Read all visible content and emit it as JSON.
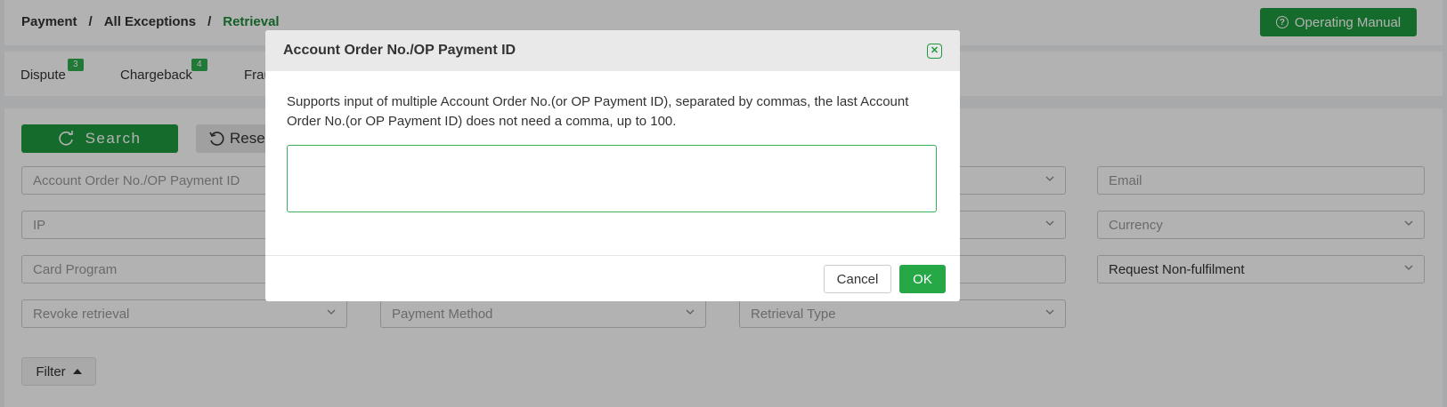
{
  "breadcrumb": {
    "items": [
      "Payment",
      "All Exceptions",
      "Retrieval"
    ],
    "separator": "/"
  },
  "header": {
    "manual_label": "Operating Manual",
    "manual_icon": "question-circle-icon"
  },
  "tabs": [
    {
      "label": "Dispute",
      "badge": "3"
    },
    {
      "label": "Chargeback",
      "badge": "4"
    },
    {
      "label": "Frau"
    }
  ],
  "actions": {
    "search_label": "Search",
    "search_icon": "refresh-search-icon",
    "reset_label": "Rese",
    "reset_icon": "reset-icon"
  },
  "filters": {
    "account_order": "Account Order No./OP Payment ID",
    "email": "Email",
    "ip": "IP",
    "currency": "Currency",
    "card_program": "Card Program",
    "request_type": "Request Non-fulfilment",
    "revoke": "Revoke retrieval",
    "payment_method": "Payment Method",
    "retrieval_type": "Retrieval Type"
  },
  "filter_toggle": {
    "label": "Filter"
  },
  "modal": {
    "title": "Account Order No./OP Payment ID",
    "description": "Supports input of multiple Account Order No.(or OP Payment ID), separated by commas, the last Account Order No.(or OP Payment ID) does not need a comma, up to 100.",
    "textarea_value": "",
    "cancel_label": "Cancel",
    "ok_label": "OK"
  },
  "colors": {
    "brand_green": "#1f9a3e",
    "badge_green": "#2fae4e",
    "overlay": "rgba(0,0,0,0.3)"
  }
}
